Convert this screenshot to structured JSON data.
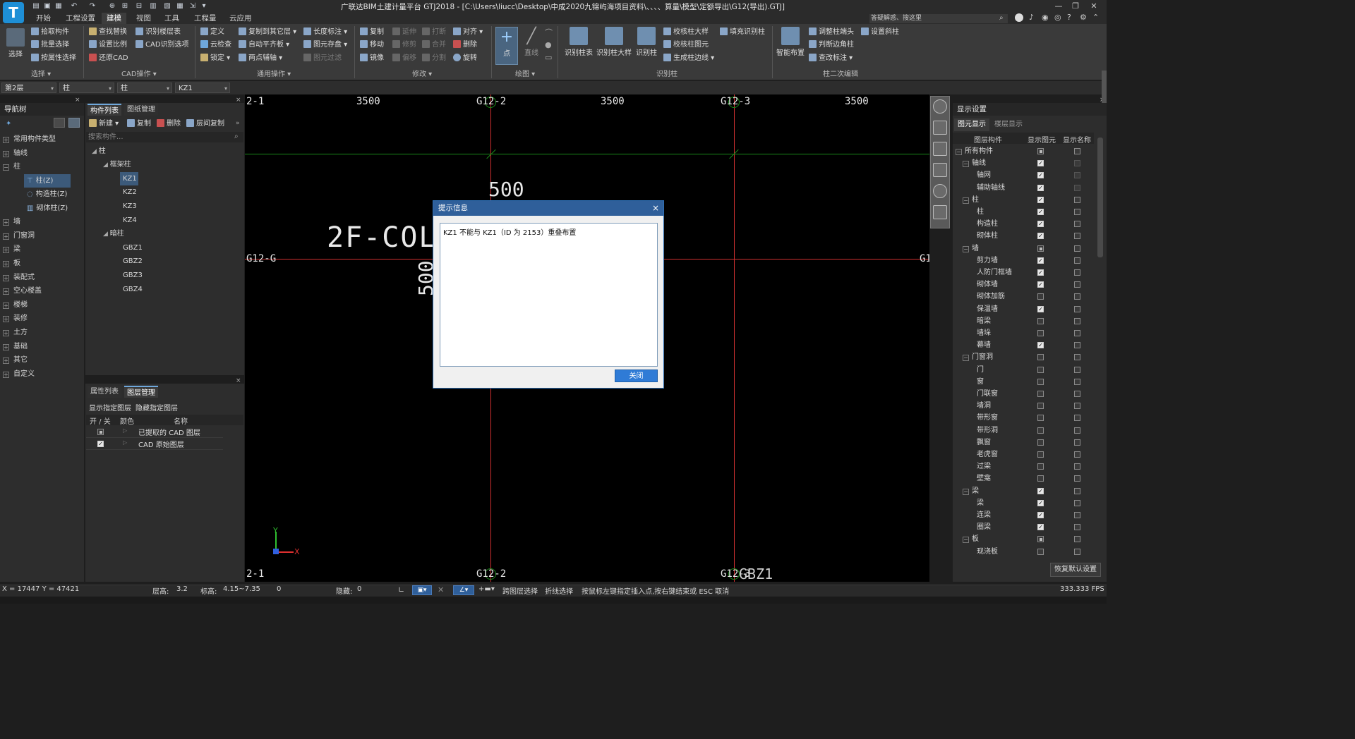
{
  "app": {
    "title": "广联达BIM土建计量平台 GTJ2018 - [C:\\Users\\liucc\\Desktop\\中成2020九锦屿海项目资料\\、、、、算量\\模型\\定额导出\\G12(导出).GTJ]",
    "search_placeholder": "答疑解惑、搜这里",
    "logo": "T"
  },
  "menu": {
    "tabs": [
      "开始",
      "工程设置",
      "建模",
      "视图",
      "工具",
      "工程量",
      "云应用"
    ],
    "active": "建模"
  },
  "ribbon": {
    "select": {
      "big": "选择",
      "items": [
        "拾取构件",
        "批量选择",
        "按属性选择"
      ],
      "group": "选择"
    },
    "cad": {
      "items": [
        "查找替换",
        "识别楼层表",
        "设置比例",
        "CAD识别选项",
        "还原CAD"
      ],
      "group": "CAD操作"
    },
    "common": {
      "items": [
        "定义",
        "复制到其它层",
        "长度标注",
        "云检查",
        "自动平齐板",
        "图元存盘",
        "锁定",
        "两点辅轴",
        "图元过滤"
      ],
      "group": "通用操作"
    },
    "modify": {
      "items": [
        "复制",
        "延伸",
        "打断",
        "对齐",
        "移动",
        "修剪",
        "合并",
        "删除",
        "镜像",
        "偏移",
        "分割",
        "旋转"
      ],
      "group": "修改"
    },
    "draw": {
      "items": [
        "点",
        "直线"
      ],
      "group": "绘图"
    },
    "recog_col": {
      "items": [
        "识别柱表",
        "识别柱大样",
        "识别柱",
        "校核柱大样",
        "填充识别柱",
        "校核柱图元",
        "生成柱边线"
      ],
      "group": "识别柱"
    },
    "col_edit": {
      "items": [
        "智能布置",
        "调整柱端头",
        "设置斜柱",
        "判断边角柱",
        "查改标注"
      ],
      "group": "柱二次编辑"
    }
  },
  "selectors": [
    "第2层",
    "柱",
    "柱",
    "KZ1"
  ],
  "nav": {
    "title": "导航树",
    "items": [
      "常用构件类型",
      "轴线",
      "柱",
      "柱(Z)",
      "构造柱(Z)",
      "砌体柱(Z)",
      "墙",
      "门窗洞",
      "梁",
      "板",
      "装配式",
      "空心楼盖",
      "楼梯",
      "装修",
      "土方",
      "基础",
      "其它",
      "自定义"
    ]
  },
  "components": {
    "tabs": [
      "构件列表",
      "图纸管理"
    ],
    "toolbar": [
      "新建",
      "复制",
      "删除",
      "层间复制"
    ],
    "search_placeholder": "搜索构件...",
    "tree": [
      "柱",
      "框架柱",
      "KZ1",
      "KZ2",
      "KZ3",
      "KZ4",
      "暗柱",
      "GBZ1",
      "GBZ2",
      "GBZ3",
      "GBZ4"
    ]
  },
  "props": {
    "tabs": [
      "属性列表",
      "图层管理"
    ],
    "links": [
      "显示指定图层",
      "隐藏指定图层"
    ],
    "columns": [
      "开 / 关",
      "颜色",
      "名称"
    ],
    "rows": [
      "已提取的 CAD 图层",
      "CAD 原始图层"
    ]
  },
  "canvas": {
    "top_labels": [
      "2-1",
      "3500",
      "G12-2",
      "3500",
      "G12-3",
      "3500"
    ],
    "bottom_labels": [
      "2-1",
      "G12-2",
      "G12-3",
      "GBZ1"
    ],
    "row_label_left": "G12-G",
    "row_label_right": "G12-G",
    "dim_500": "500",
    "dim_500v": "500",
    "cad_text": "2F-COLU",
    "kz_text": "KZ",
    "axis_x": "X",
    "axis_y": "Y"
  },
  "dialog": {
    "title": "提示信息",
    "message": "KZ1 不能与 KZ1（ID 为 2153）重叠布置",
    "close_label": "关闭",
    "close_icon": "×"
  },
  "display": {
    "title": "显示设置",
    "tabs": [
      "图元显示",
      "楼层显示"
    ],
    "headers": [
      "图层构件",
      "显示图元",
      "显示名称"
    ],
    "rows": [
      {
        "name": "所有构件",
        "level": 0,
        "group": true,
        "show": "part",
        "label": "off"
      },
      {
        "name": "轴线",
        "level": 1,
        "group": true,
        "show": "on",
        "label": "dim"
      },
      {
        "name": "轴网",
        "level": 2,
        "group": false,
        "show": "on",
        "label": "dim"
      },
      {
        "name": "辅助轴线",
        "level": 2,
        "group": false,
        "show": "on",
        "label": "dim"
      },
      {
        "name": "柱",
        "level": 1,
        "group": true,
        "show": "on",
        "label": "off"
      },
      {
        "name": "柱",
        "level": 2,
        "group": false,
        "show": "on",
        "label": "off"
      },
      {
        "name": "构造柱",
        "level": 2,
        "group": false,
        "show": "on",
        "label": "off"
      },
      {
        "name": "砌体柱",
        "level": 2,
        "group": false,
        "show": "on",
        "label": "off"
      },
      {
        "name": "墙",
        "level": 1,
        "group": true,
        "show": "part",
        "label": "off"
      },
      {
        "name": "剪力墙",
        "level": 2,
        "group": false,
        "show": "on",
        "label": "off"
      },
      {
        "name": "人防门框墙",
        "level": 2,
        "group": false,
        "show": "on",
        "label": "off"
      },
      {
        "name": "砌体墙",
        "level": 2,
        "group": false,
        "show": "on",
        "label": "off"
      },
      {
        "name": "砌体加筋",
        "level": 2,
        "group": false,
        "show": "off",
        "label": "off"
      },
      {
        "name": "保温墙",
        "level": 2,
        "group": false,
        "show": "on",
        "label": "off"
      },
      {
        "name": "暗梁",
        "level": 2,
        "group": false,
        "show": "off",
        "label": "off"
      },
      {
        "name": "墙垛",
        "level": 2,
        "group": false,
        "show": "off",
        "label": "off"
      },
      {
        "name": "幕墙",
        "level": 2,
        "group": false,
        "show": "on",
        "label": "off"
      },
      {
        "name": "门窗洞",
        "level": 1,
        "group": true,
        "show": "off",
        "label": "off"
      },
      {
        "name": "门",
        "level": 2,
        "group": false,
        "show": "off",
        "label": "off"
      },
      {
        "name": "窗",
        "level": 2,
        "group": false,
        "show": "off",
        "label": "off"
      },
      {
        "name": "门联窗",
        "level": 2,
        "group": false,
        "show": "off",
        "label": "off"
      },
      {
        "name": "墙洞",
        "level": 2,
        "group": false,
        "show": "off",
        "label": "off"
      },
      {
        "name": "带形窗",
        "level": 2,
        "group": false,
        "show": "off",
        "label": "off"
      },
      {
        "name": "带形洞",
        "level": 2,
        "group": false,
        "show": "off",
        "label": "off"
      },
      {
        "name": "飘窗",
        "level": 2,
        "group": false,
        "show": "off",
        "label": "off"
      },
      {
        "name": "老虎窗",
        "level": 2,
        "group": false,
        "show": "off",
        "label": "off"
      },
      {
        "name": "过梁",
        "level": 2,
        "group": false,
        "show": "off",
        "label": "off"
      },
      {
        "name": "壁龛",
        "level": 2,
        "group": false,
        "show": "off",
        "label": "off"
      },
      {
        "name": "梁",
        "level": 1,
        "group": true,
        "show": "on",
        "label": "off"
      },
      {
        "name": "梁",
        "level": 2,
        "group": false,
        "show": "on",
        "label": "off"
      },
      {
        "name": "连梁",
        "level": 2,
        "group": false,
        "show": "on",
        "label": "off"
      },
      {
        "name": "圈梁",
        "level": 2,
        "group": false,
        "show": "on",
        "label": "off"
      },
      {
        "name": "板",
        "level": 1,
        "group": true,
        "show": "part",
        "label": "off"
      },
      {
        "name": "现浇板",
        "level": 2,
        "group": false,
        "show": "off",
        "label": "off"
      }
    ],
    "restore_label": "恢复默认设置"
  },
  "status": {
    "coords": "X = 17447 Y = 47421",
    "floor_height_label": "层高:",
    "floor_height": "3.2",
    "elev_label": "标高:",
    "elev": "4.15~7.35",
    "zero": "0",
    "hidden_label": "隐藏:",
    "hidden": "0",
    "cross_layer": "跨图层选择",
    "polyline_select": "折线选择",
    "hint": "按鼠标左键指定插入点,按右键结束或 ESC 取消",
    "fps": "333.333 FPS"
  }
}
